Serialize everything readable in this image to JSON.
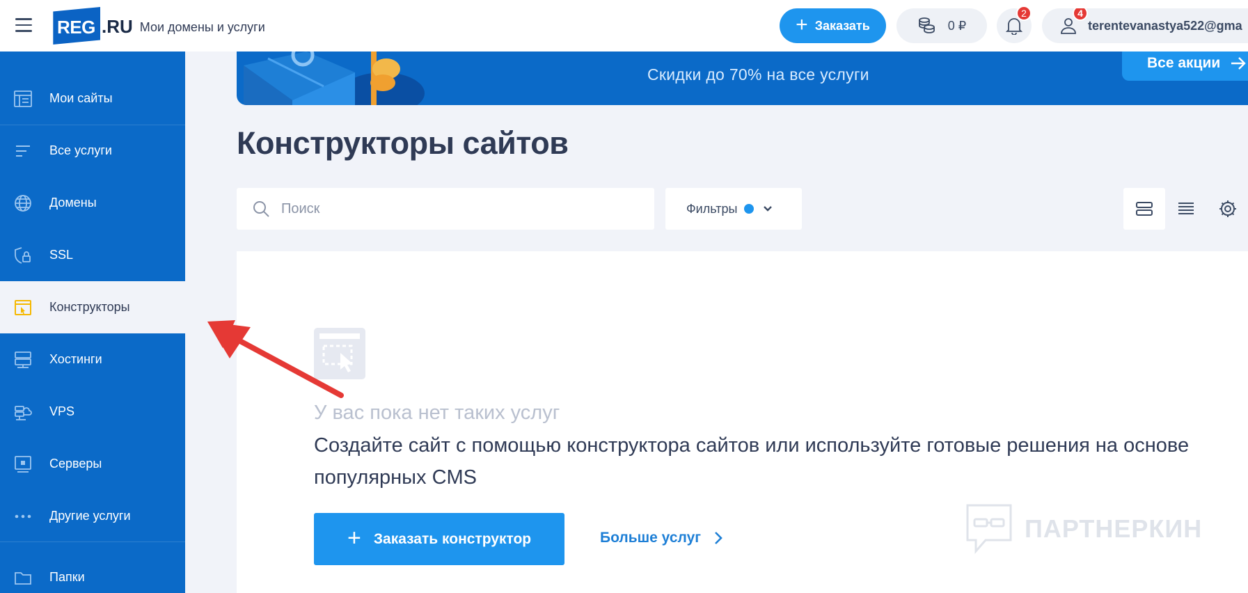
{
  "header": {
    "logo_reg": "REG",
    "logo_ru": ".RU",
    "subtitle": "Мои домены и услуги",
    "order_label": "Заказать",
    "balance": "0 ₽",
    "notifications_count": "2",
    "user_notifications_count": "4",
    "user_email": "terentevanastya522@gma"
  },
  "sidebar": {
    "items": [
      {
        "label": "Мои сайты",
        "icon": "my-sites-icon"
      },
      {
        "label": "Все услуги",
        "icon": "list-icon"
      },
      {
        "label": "Домены",
        "icon": "globe-icon"
      },
      {
        "label": "SSL",
        "icon": "shield-lock-icon"
      },
      {
        "label": "Конструкторы",
        "icon": "constructor-icon",
        "active": true
      },
      {
        "label": "Хостинги",
        "icon": "hosting-icon"
      },
      {
        "label": "VPS",
        "icon": "vps-cloud-icon"
      },
      {
        "label": "Серверы",
        "icon": "server-icon"
      },
      {
        "label": "Другие услуги",
        "icon": "dots-icon"
      },
      {
        "label": "Папки",
        "icon": "folder-icon"
      }
    ]
  },
  "banner": {
    "promo_text": "Скидки до 70% на все услуги",
    "all_deals_label": "Все акции"
  },
  "page": {
    "title": "Конструкторы сайтов"
  },
  "toolbar": {
    "search_placeholder": "Поиск",
    "filters_label": "Фильтры"
  },
  "empty_state": {
    "title": "У вас пока нет таких услуг",
    "description": "Создайте сайт с помощью конструктора сайтов или используйте готовые решения на основе популярных CMS",
    "cta_label": "Заказать конструктор",
    "more_label": "Больше услуг"
  },
  "watermark": "ПАРТНЕРКИН",
  "colors": {
    "brand_blue": "#0b6ac8",
    "accent_blue": "#1e95ee",
    "badge_red": "#e53935",
    "active_icon_yellow": "#f5b800"
  }
}
